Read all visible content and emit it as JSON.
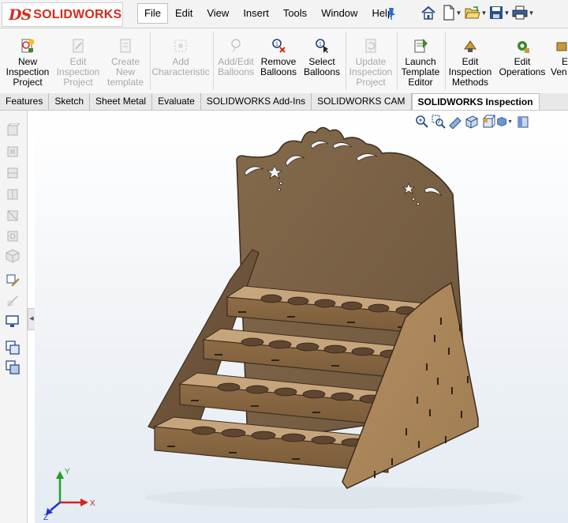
{
  "app": {
    "logo_prefix": "DS",
    "logo_word": "SOLIDWORKS"
  },
  "menu": [
    "File",
    "Edit",
    "View",
    "Insert",
    "Tools",
    "Window",
    "Help"
  ],
  "menu_active": "File",
  "quick_access": [
    "home-icon",
    "new-document-icon",
    "open-folder-icon",
    "save-icon",
    "print-icon"
  ],
  "ribbon": [
    {
      "line1": "New",
      "line2": "Inspection",
      "line3": "Project",
      "enabled": true
    },
    {
      "line1": "Edit",
      "line2": "Inspection",
      "line3": "Project",
      "enabled": false
    },
    {
      "line1": "Create",
      "line2": "New",
      "line3": "template",
      "enabled": false
    },
    {
      "line1": "Add",
      "line2": "Characteristic",
      "line3": "",
      "enabled": false
    },
    {
      "line1": "Add/Edit",
      "line2": "Balloons",
      "line3": "",
      "enabled": false
    },
    {
      "line1": "Remove",
      "line2": "Balloons",
      "line3": "",
      "enabled": true
    },
    {
      "line1": "Select",
      "line2": "Balloons",
      "line3": "",
      "enabled": true
    },
    {
      "line1": "Update",
      "line2": "Inspection",
      "line3": "Project",
      "enabled": false
    },
    {
      "line1": "Launch",
      "line2": "Template",
      "line3": "Editor",
      "enabled": true
    },
    {
      "line1": "Edit",
      "line2": "Inspection",
      "line3": "Methods",
      "enabled": true
    },
    {
      "line1": "Edit",
      "line2": "Operations",
      "line3": "",
      "enabled": true
    },
    {
      "line1": "Ec",
      "line2": "Ven",
      "line3": "",
      "enabled": true
    }
  ],
  "tabs": [
    "Features",
    "Sketch",
    "Sheet Metal",
    "Evaluate",
    "SOLIDWORKS Add-Ins",
    "SOLIDWORKS CAM",
    "SOLIDWORKS Inspection"
  ],
  "tab_active": "SOLIDWORKS Inspection",
  "triad": {
    "y": "Y",
    "x": "X",
    "z": "Z"
  },
  "colors": {
    "logo_red": "#d52b1e",
    "wood_front": "#8a6a43",
    "wood_side": "#b08a5e",
    "wood_dark": "#5e4631",
    "backboard": "#7d6447",
    "axis_x": "#d22222",
    "axis_y": "#22a022",
    "axis_z": "#2233cc"
  }
}
